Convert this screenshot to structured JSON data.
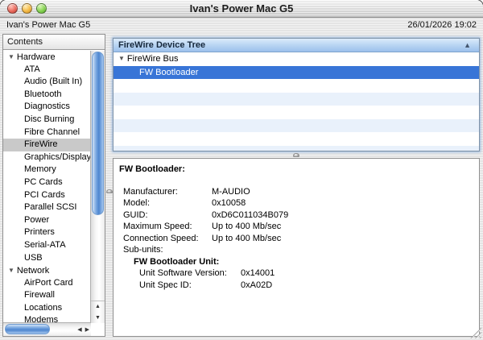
{
  "window": {
    "title": "Ivan's Power Mac G5"
  },
  "info_bar": {
    "computer_name": "Ivan's Power Mac G5",
    "datetime": "26/01/2026 19:02"
  },
  "icons": {
    "disclosure_expanded": "▼",
    "sort_ascending": "▲",
    "scroll_up": "▲",
    "scroll_down": "▼",
    "scroll_left": "◀",
    "scroll_right": "▶"
  },
  "colors": {
    "selection_blue": "#3875d7",
    "row_stripe_blue": "#e9f1fb",
    "sidebar_selection_gray": "#c9c9c9",
    "tree_header_top": "#dcebfb",
    "tree_header_bottom": "#9cc0ec"
  },
  "sidebar": {
    "header": "Contents",
    "items": [
      {
        "label": "Hardware",
        "type": "group"
      },
      {
        "label": "ATA"
      },
      {
        "label": "Audio (Built In)"
      },
      {
        "label": "Bluetooth"
      },
      {
        "label": "Diagnostics"
      },
      {
        "label": "Disc Burning"
      },
      {
        "label": "Fibre Channel"
      },
      {
        "label": "FireWire",
        "selected": true
      },
      {
        "label": "Graphics/Displays"
      },
      {
        "label": "Memory"
      },
      {
        "label": "PC Cards"
      },
      {
        "label": "PCI Cards"
      },
      {
        "label": "Parallel SCSI"
      },
      {
        "label": "Power"
      },
      {
        "label": "Printers"
      },
      {
        "label": "Serial-ATA"
      },
      {
        "label": "USB"
      },
      {
        "label": "Network",
        "type": "group"
      },
      {
        "label": "AirPort Card"
      },
      {
        "label": "Firewall"
      },
      {
        "label": "Locations"
      },
      {
        "label": "Modems"
      }
    ]
  },
  "device_tree": {
    "header": "FireWire Device Tree",
    "rows": [
      {
        "label": "FireWire Bus",
        "type": "group"
      },
      {
        "label": "FW Bootloader",
        "selected": true
      }
    ]
  },
  "details": {
    "title": "FW Bootloader:",
    "fields": [
      {
        "label": "Manufacturer:",
        "value": "M-AUDIO"
      },
      {
        "label": "Model:",
        "value": "0x10058"
      },
      {
        "label": "GUID:",
        "value": "0xD6C011034B079"
      },
      {
        "label": "Maximum Speed:",
        "value": "Up to 400 Mb/sec"
      },
      {
        "label": "Connection Speed:",
        "value": "Up to 400 Mb/sec"
      },
      {
        "label": "Sub-units:",
        "value": ""
      }
    ],
    "subunit": {
      "title": "FW Bootloader Unit:",
      "fields": [
        {
          "label": "Unit Software Version:",
          "value": "0x14001"
        },
        {
          "label": "Unit Spec ID:",
          "value": "0xA02D"
        }
      ]
    }
  }
}
